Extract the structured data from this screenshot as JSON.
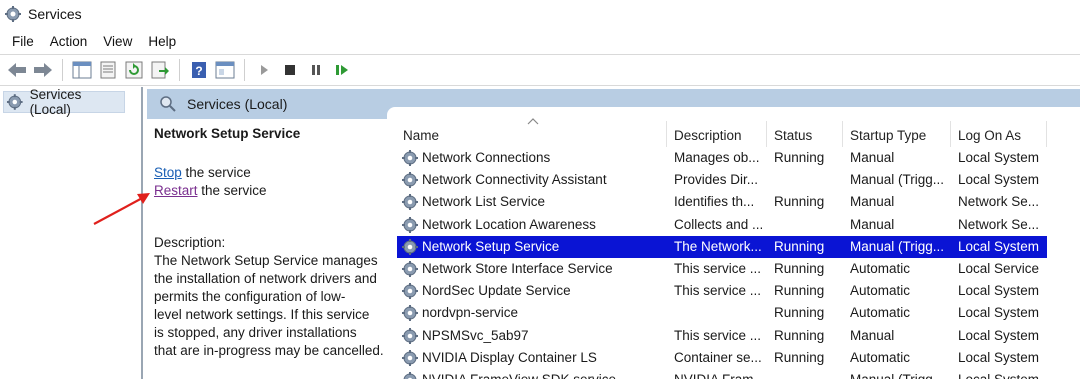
{
  "window": {
    "title": "Services",
    "icon": "services-gear-icon"
  },
  "menu": [
    "File",
    "Action",
    "View",
    "Help"
  ],
  "toolbar": {
    "buttons": [
      "back-arrow-icon",
      "forward-arrow-icon",
      "console-tree-icon",
      "properties-icon",
      "refresh-icon",
      "export-list-icon",
      "help-icon",
      "view-icon",
      "start-icon",
      "stop-icon",
      "pause-icon",
      "restart-icon"
    ]
  },
  "tree": {
    "root_label": "Services (Local)"
  },
  "header": {
    "title": "Services (Local)"
  },
  "detail": {
    "service_name": "Network Setup Service",
    "stop_link": "Stop",
    "stop_suffix": " the service",
    "restart_link": "Restart",
    "restart_suffix": " the service",
    "description_label": "Description:",
    "description_lines": [
      "The Network Setup Service manages",
      "the installation of network drivers and",
      "permits the configuration of low-",
      "level network settings.  If this service",
      "is stopped, any driver installations",
      "that are in-progress may be cancelled."
    ]
  },
  "columns": [
    "Name",
    "Description",
    "Status",
    "Startup Type",
    "Log On As"
  ],
  "rows": [
    {
      "name": "Network Connections",
      "description": "Manages ob...",
      "status": "Running",
      "startup": "Manual",
      "logon": "Local System"
    },
    {
      "name": "Network Connectivity Assistant",
      "description": "Provides Dir...",
      "status": "",
      "startup": "Manual (Trigg...",
      "logon": "Local System"
    },
    {
      "name": "Network List Service",
      "description": "Identifies th...",
      "status": "Running",
      "startup": "Manual",
      "logon": "Network Se..."
    },
    {
      "name": "Network Location Awareness",
      "description": "Collects and ...",
      "status": "",
      "startup": "Manual",
      "logon": "Network Se..."
    },
    {
      "name": "Network Setup Service",
      "description": "The Network...",
      "status": "Running",
      "startup": "Manual (Trigg...",
      "logon": "Local System",
      "selected": true
    },
    {
      "name": "Network Store Interface Service",
      "description": "This service ...",
      "status": "Running",
      "startup": "Automatic",
      "logon": "Local Service"
    },
    {
      "name": "NordSec Update Service",
      "description": "This service ...",
      "status": "Running",
      "startup": "Automatic",
      "logon": "Local System"
    },
    {
      "name": "nordvpn-service",
      "description": "",
      "status": "Running",
      "startup": "Automatic",
      "logon": "Local System"
    },
    {
      "name": "NPSMSvc_5ab97",
      "description": "This service ...",
      "status": "Running",
      "startup": "Manual",
      "logon": "Local System"
    },
    {
      "name": "NVIDIA Display Container LS",
      "description": "Container se...",
      "status": "Running",
      "startup": "Automatic",
      "logon": "Local System"
    },
    {
      "name": "NVIDIA FrameView SDK service",
      "description": "NVIDIA Fram...",
      "status": "",
      "startup": "Manual (Trigg...",
      "logon": "Local System"
    }
  ],
  "colors": {
    "selection": "#0a14d4",
    "header_band": "#b8cde3",
    "link": "#1a5fb4",
    "annotation_arrow": "#e0201c"
  }
}
